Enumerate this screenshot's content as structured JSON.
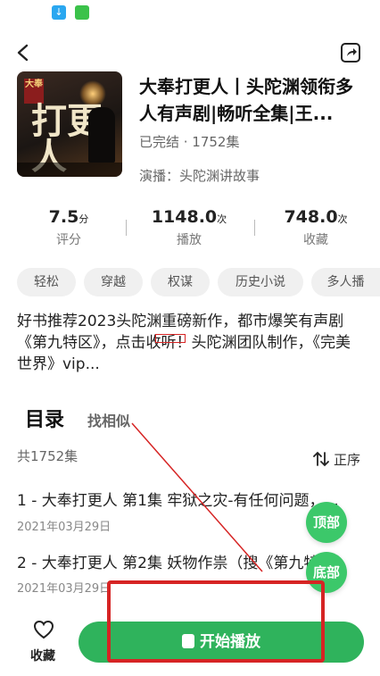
{
  "album": {
    "title": "大奉打更人丨头陀渊领衔多人有声剧|畅听全集|王...",
    "status": "已完结 · 1752集",
    "narrator": "演播：头陀渊讲故事",
    "cover": {
      "tag": "大奉",
      "big_text": "打更人"
    }
  },
  "stats": [
    {
      "value": "7.5",
      "unit": "分",
      "label": "评分"
    },
    {
      "value": "1148.0",
      "unit": "次",
      "label": "播放"
    },
    {
      "value": "748.0",
      "unit": "次",
      "label": "收藏"
    }
  ],
  "tags": [
    "轻松",
    "穿越",
    "权谋",
    "历史小说",
    "多人播"
  ],
  "description": "好书推荐2023头陀渊重磅新作，都市爆笑有声剧《第九特区》，点击收听！头陀渊团队制作，《完美世界》vip...",
  "toc": {
    "title": "目录",
    "similar": "找相似",
    "count": "共1752集",
    "order": "正序"
  },
  "episodes": [
    {
      "title": "1 - 大奉打更人 第1集 牢狱之灾-有任何问题，...",
      "date": "2021年03月29日"
    },
    {
      "title": "2 - 大奉打更人 第2集 妖物作祟（搜《第九特...",
      "date": "2021年03月29日"
    }
  ],
  "float": {
    "top": "顶部",
    "bottom": "底部"
  },
  "bottom_bar": {
    "favorite": "收藏",
    "play": "开始播放"
  },
  "colors": {
    "accent": "#2fb35c",
    "annotation": "#d62424"
  }
}
